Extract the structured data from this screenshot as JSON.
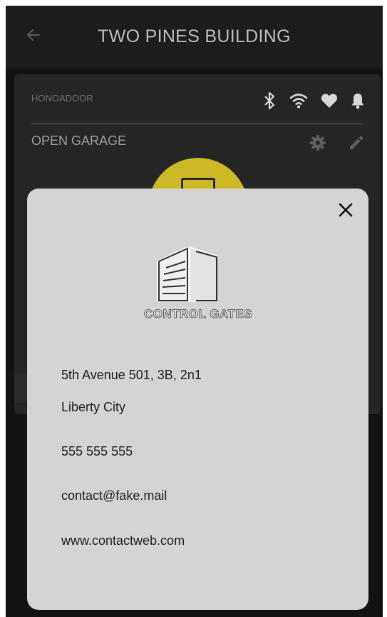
{
  "header": {
    "back_icon": "arrow-left-icon",
    "title": "TWO PINES BUILDING"
  },
  "device_card": {
    "device_name": "HONOADOOR",
    "status_icons": [
      "bluetooth-icon",
      "wifi-icon",
      "heart-icon",
      "bell-icon"
    ],
    "action_label": "OPEN GARAGE",
    "action_icons": [
      "gear-icon",
      "pencil-icon"
    ],
    "open_button_color": "#cdb825"
  },
  "contact_modal": {
    "logo_text": "CONTROL GATES",
    "address_line1": "5th Avenue 501, 3B, 2n1",
    "address_line2": "Liberty City",
    "phone": "555 555 555",
    "email": "contact@fake.mail",
    "website": "www.contactweb.com",
    "close_icon": "close-icon"
  },
  "colors": {
    "background": "#121212",
    "appbar": "#1c1c1c",
    "card": "#252525",
    "modal": "#d4d4d4",
    "accent": "#cdb825"
  }
}
